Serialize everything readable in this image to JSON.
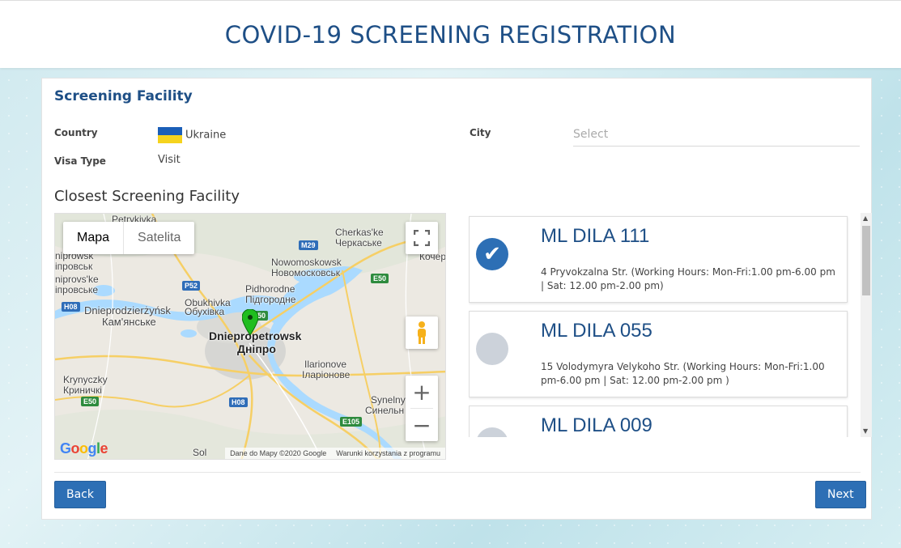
{
  "header": {
    "title": "COVID-19 SCREENING REGISTRATION"
  },
  "facility_section": {
    "title": "Screening Facility",
    "country_label": "Country",
    "country_value": "Ukraine",
    "city_label": "City",
    "city_placeholder": "Select",
    "visa_label": "Visa Type",
    "visa_value": "Visit",
    "closest_title": "Closest Screening Facility"
  },
  "map": {
    "type_map": "Mapa",
    "type_satellite": "Satelita",
    "attribution": "Dane do Mapy ©2020 Google",
    "terms": "Warunki korzystania z programu",
    "google": "Google",
    "places": [
      {
        "id": "petrykivka",
        "text": "Petrykivka"
      },
      {
        "id": "cherkaske-lat",
        "text": "Cherkas'ke"
      },
      {
        "id": "cherkaske-cyr",
        "text": "Черкаське"
      },
      {
        "id": "nipr-lat",
        "text": "niprowsk"
      },
      {
        "id": "nipr-cyr",
        "text": "іпровськ"
      },
      {
        "id": "nipr2-lat",
        "text": "niprovs'ke"
      },
      {
        "id": "nipr2-cyr",
        "text": "іпровське"
      },
      {
        "id": "kocher",
        "text": "Кочер"
      },
      {
        "id": "novomosk-lat",
        "text": "Nowomoskowsk"
      },
      {
        "id": "novomosk-cyr",
        "text": "Новомосковськ"
      },
      {
        "id": "pidhorodne-lat",
        "text": "Pidhorodne"
      },
      {
        "id": "pidhorodne-cyr",
        "text": "Підгородне"
      },
      {
        "id": "obukhivka-lat",
        "text": "Obukhivka"
      },
      {
        "id": "obukhivka-cyr",
        "text": "Обухівка"
      },
      {
        "id": "dnieprodz-lat",
        "text": "Dnieprodzierżyńsk"
      },
      {
        "id": "dnieprodz-cyr",
        "text": "Кам'янське"
      },
      {
        "id": "dnipro-lat",
        "text": "Dniepropetrowsk"
      },
      {
        "id": "dnipro-cyr",
        "text": "Дніпро"
      },
      {
        "id": "ilarionove-lat",
        "text": "Ilarionove"
      },
      {
        "id": "ilarionove-cyr",
        "text": "Іларіонове"
      },
      {
        "id": "krynychky-lat",
        "text": "Krynyczky"
      },
      {
        "id": "krynychky-cyr",
        "text": "Криничкі"
      },
      {
        "id": "synelnyk-lat",
        "text": "Synelnyk"
      },
      {
        "id": "synelnyk-cyr",
        "text": "Синельн"
      },
      {
        "id": "sol",
        "text": "Sol"
      }
    ],
    "roads": [
      {
        "id": "m29",
        "text": "M29",
        "color": "#2f6db8"
      },
      {
        "id": "p52",
        "text": "P52",
        "color": "#2f6db8"
      },
      {
        "id": "e50-1",
        "text": "E50",
        "color": "#2e8b3e"
      },
      {
        "id": "h08-1",
        "text": "H08",
        "color": "#2f6db8"
      },
      {
        "id": "e50-2",
        "text": "E50",
        "color": "#2e8b3e"
      },
      {
        "id": "h08-2",
        "text": "H08",
        "color": "#2f6db8"
      },
      {
        "id": "e105",
        "text": "E105",
        "color": "#2e8b3e"
      },
      {
        "id": "e50-3",
        "text": "E50",
        "color": "#2e8b3e"
      }
    ]
  },
  "facilities": [
    {
      "name": "ML DILA 111",
      "address": "4 Pryvokzalna Str. (Working Hours: Mon-Fri:1.00 pm-6.00 pm | Sat: 12.00 pm-2.00 pm)",
      "selected": true
    },
    {
      "name": "ML DILA 055",
      "address": "15 Volodymyra Velykoho Str. (Working Hours: Mon-Fri:1.00 pm-6.00 pm | Sat: 12.00 pm-2.00 pm )",
      "selected": false
    },
    {
      "name": "ML DILA 009",
      "address": "",
      "selected": false
    }
  ],
  "buttons": {
    "back": "Back",
    "next": "Next"
  },
  "colors": {
    "brand": "#1e4f86",
    "button": "#2d6fb5",
    "radio_unselected": "#ccd2da"
  }
}
